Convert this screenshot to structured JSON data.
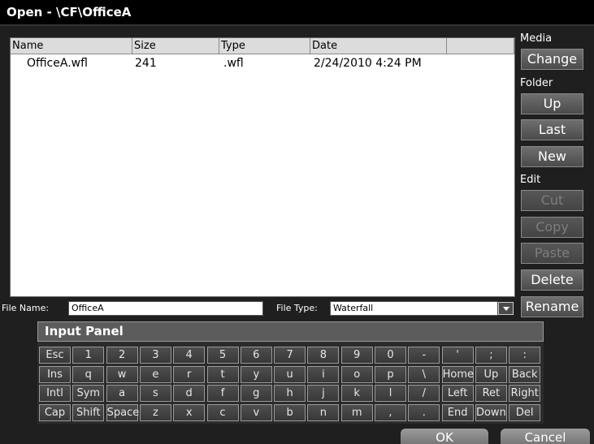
{
  "window": {
    "title": "Open - \\CF\\OfficeA"
  },
  "columns": [
    "Name",
    "Size",
    "Type",
    "Date",
    ""
  ],
  "files": [
    {
      "name": "OfficeA.wfl",
      "size": "241",
      "type": ".wfl",
      "date": "2/24/2010 4:24 PM"
    }
  ],
  "sidebar": {
    "media_label": "Media",
    "change": "Change",
    "folder_label": "Folder",
    "up": "Up",
    "last": "Last",
    "new": "New",
    "edit_label": "Edit",
    "cut": "Cut",
    "copy": "Copy",
    "paste": "Paste",
    "delete": "Delete",
    "rename": "Rename"
  },
  "filename": {
    "label": "File Name:",
    "value": "OfficeA"
  },
  "filetype": {
    "label": "File Type:",
    "value": "Waterfall"
  },
  "input_panel": {
    "title": "Input Panel",
    "rows": [
      [
        "Esc",
        "1",
        "2",
        "3",
        "4",
        "5",
        "6",
        "7",
        "8",
        "9",
        "0",
        "-",
        "'",
        ";",
        ":"
      ],
      [
        "Ins",
        "q",
        "w",
        "e",
        "r",
        "t",
        "y",
        "u",
        "i",
        "o",
        "p",
        "\\",
        "Home",
        "Up",
        "Back"
      ],
      [
        "Intl",
        "Sym",
        "a",
        "s",
        "d",
        "f",
        "g",
        "h",
        "j",
        "k",
        "l",
        "/",
        "Left",
        "Ret",
        "Right"
      ],
      [
        "Cap",
        "Shift",
        "Space",
        "z",
        "x",
        "c",
        "v",
        "b",
        "n",
        "m",
        ",",
        ".",
        "End",
        "Down",
        "Del"
      ]
    ]
  },
  "buttons": {
    "ok": "OK",
    "cancel": "Cancel"
  }
}
